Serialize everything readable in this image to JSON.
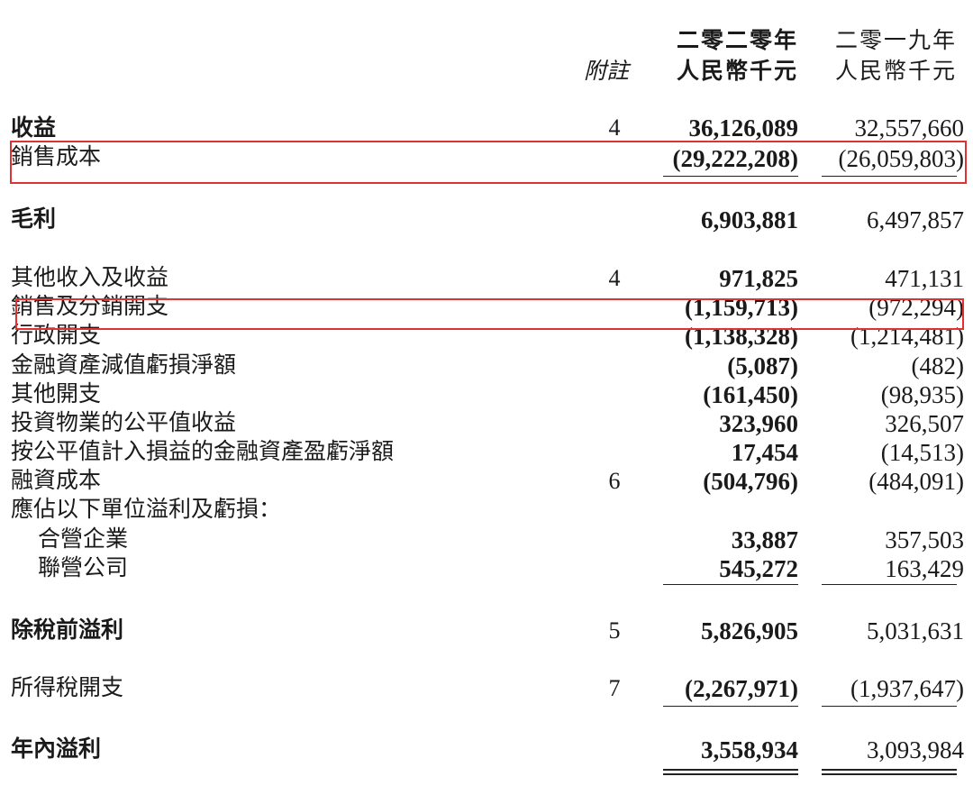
{
  "header": {
    "note_label": "附註",
    "col_2020_year": "二零二零年",
    "col_2020_unit": "人民幣千元",
    "col_2019_year": "二零一九年",
    "col_2019_unit": "人民幣千元"
  },
  "rows": [
    {
      "label": "收益",
      "note": "4",
      "y2020": "36,126,089",
      "y2019": "32,557,660"
    },
    {
      "label": "銷售成本",
      "note": "",
      "y2020": "(29,222,208)",
      "y2019": "(26,059,803)"
    },
    {
      "label": "毛利",
      "note": "",
      "y2020": "6,903,881",
      "y2019": "6,497,857"
    },
    {
      "label": "其他收入及收益",
      "note": "4",
      "y2020": "971,825",
      "y2019": "471,131"
    },
    {
      "label": "銷售及分銷開支",
      "note": "",
      "y2020": "(1,159,713)",
      "y2019": "(972,294)"
    },
    {
      "label": "行政開支",
      "note": "",
      "y2020": "(1,138,328)",
      "y2019": "(1,214,481)"
    },
    {
      "label": "金融資產減值虧損淨額",
      "note": "",
      "y2020": "(5,087)",
      "y2019": "(482)"
    },
    {
      "label": "其他開支",
      "note": "",
      "y2020": "(161,450)",
      "y2019": "(98,935)"
    },
    {
      "label": "投資物業的公平值收益",
      "note": "",
      "y2020": "323,960",
      "y2019": "326,507"
    },
    {
      "label": "按公平值計入損益的金融資產盈虧淨額",
      "note": "",
      "y2020": "17,454",
      "y2019": "(14,513)"
    },
    {
      "label": "融資成本",
      "note": "6",
      "y2020": "(504,796)",
      "y2019": "(484,091)"
    },
    {
      "label": "應佔以下單位溢利及虧損：",
      "note": "",
      "y2020": "",
      "y2019": ""
    },
    {
      "label": "合營企業",
      "note": "",
      "y2020": "33,887",
      "y2019": "357,503"
    },
    {
      "label": "聯營公司",
      "note": "",
      "y2020": "545,272",
      "y2019": "163,429"
    },
    {
      "label": "除稅前溢利",
      "note": "5",
      "y2020": "5,826,905",
      "y2019": "5,031,631"
    },
    {
      "label": "所得稅開支",
      "note": "7",
      "y2020": "(2,267,971)",
      "y2019": "(1,937,647)"
    },
    {
      "label": "年內溢利",
      "note": "",
      "y2020": "3,558,934",
      "y2019": "3,093,984"
    }
  ]
}
